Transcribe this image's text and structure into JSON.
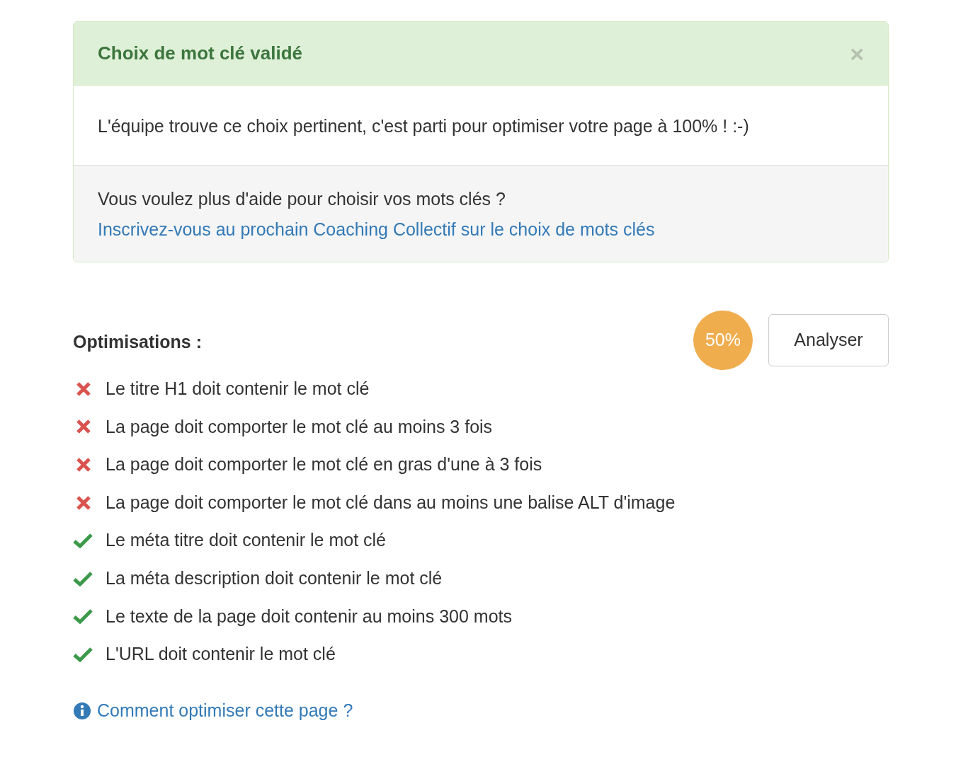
{
  "alert": {
    "title": "Choix de mot clé validé",
    "close": "×",
    "message": "L'équipe trouve ce choix pertinent, c'est parti pour optimiser votre page à 100% ! :-)",
    "help_question": "Vous voulez plus d'aide pour choisir vos mots clés ?",
    "help_link": "Inscrivez-vous au prochain Coaching Collectif sur le choix de mots clés"
  },
  "optimisations": {
    "title": "Optimisations :",
    "score": "50%",
    "button": "Analyser",
    "items": [
      {
        "label": "Le titre H1 doit contenir le mot clé",
        "passed": false
      },
      {
        "label": "La page doit comporter le mot clé au moins 3 fois",
        "passed": false
      },
      {
        "label": "La page doit comporter le mot clé en gras d'une à 3 fois",
        "passed": false
      },
      {
        "label": "La page doit comporter le mot clé dans au moins une balise ALT d'image",
        "passed": false
      },
      {
        "label": "Le méta titre doit contenir le mot clé",
        "passed": true
      },
      {
        "label": "La méta description doit contenir le mot clé",
        "passed": true
      },
      {
        "label": "Le texte de la page doit contenir au moins 300 mots",
        "passed": true
      },
      {
        "label": "L'URL doit contenir le mot clé",
        "passed": true
      }
    ],
    "help_link": "Comment optimiser cette page ?"
  }
}
